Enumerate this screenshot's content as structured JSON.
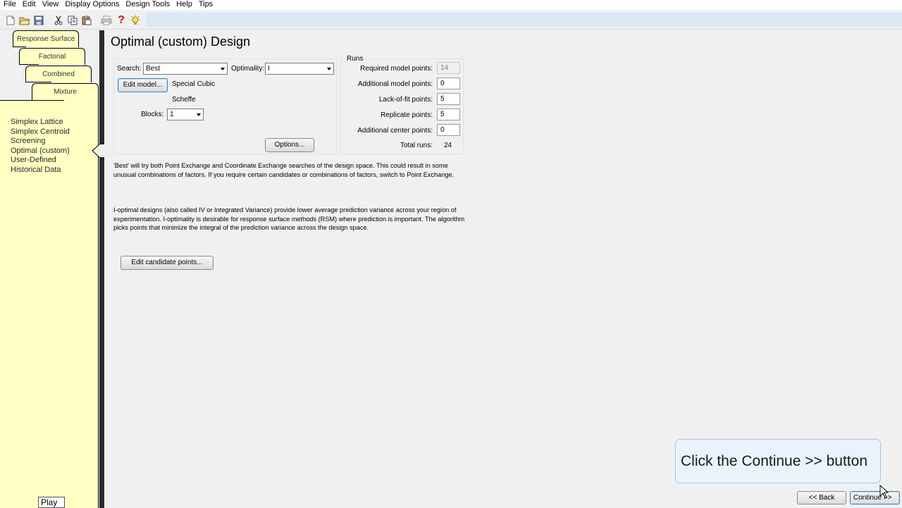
{
  "menu": [
    "File",
    "Edit",
    "View",
    "Display Options",
    "Design Tools",
    "Help",
    "Tips"
  ],
  "toolbar": {
    "icons": [
      "new-file-icon",
      "open-folder-icon",
      "save-icon",
      "cut-icon",
      "copy-icon",
      "paste-icon",
      "print-icon",
      "help-icon",
      "tip-lightbulb-icon"
    ],
    "help_glyph": "?"
  },
  "sidebar": {
    "tabs": [
      "Response Surface",
      "Factorial",
      "Combined",
      "Mixture"
    ],
    "active_tab": "Mixture",
    "design_types": [
      "Simplex Lattice",
      "Simplex Centroid",
      "Screening",
      "Optimal (custom)",
      "User-Defined",
      "Historical Data"
    ],
    "selected": "Optimal (custom)",
    "play_label": "Play"
  },
  "main": {
    "title": "Optimal (custom) Design",
    "search_label": "Search:",
    "search_value": "Best",
    "optimality_label": "Optimality:",
    "optimality_value": "I",
    "edit_model_label": "Edit model...",
    "model_name": "Special Cubic",
    "model_form": "Scheffe",
    "blocks_label": "Blocks:",
    "blocks_value": "1",
    "options_label": "Options...",
    "runs": {
      "title": "Runs",
      "required_label": "Required model points:",
      "required_value": "14",
      "additional_label": "Additional model points:",
      "additional_value": "0",
      "lof_label": "Lack-of-fit points:",
      "lof_value": "5",
      "replicate_label": "Replicate points:",
      "replicate_value": "5",
      "center_label": "Additional center points:",
      "center_value": "0",
      "total_label": "Total runs:",
      "total_value": "24"
    },
    "search_info": "'Best' will try both Point Exchange and Coordinate Exchange searches of the design space. This could result in some unusual combinations of factors. If you require certain candidates or combinations of factors, switch to Point Exchange.",
    "optimality_info": "I-optimal designs (also called IV or Integrated Variance) provide lower average prediction variance across your region of experimentation.  I-optimality is desirable for response surface methods (RSM) where prediction is important.  The algorithm picks points that minimize the integral of the prediction variance across the design space.",
    "edit_candidate_label": "Edit candidate points..."
  },
  "footer": {
    "back_label": "<< Back",
    "continue_label": "Continue >>"
  },
  "tutorial": {
    "callout": "Click the Continue >> button"
  },
  "colors": {
    "sidebar_bg": "#ffffc4",
    "toolbar_strip": "#dde8f6",
    "callout_bg": "#eaf3fb",
    "callout_border": "#9ccaf0"
  }
}
